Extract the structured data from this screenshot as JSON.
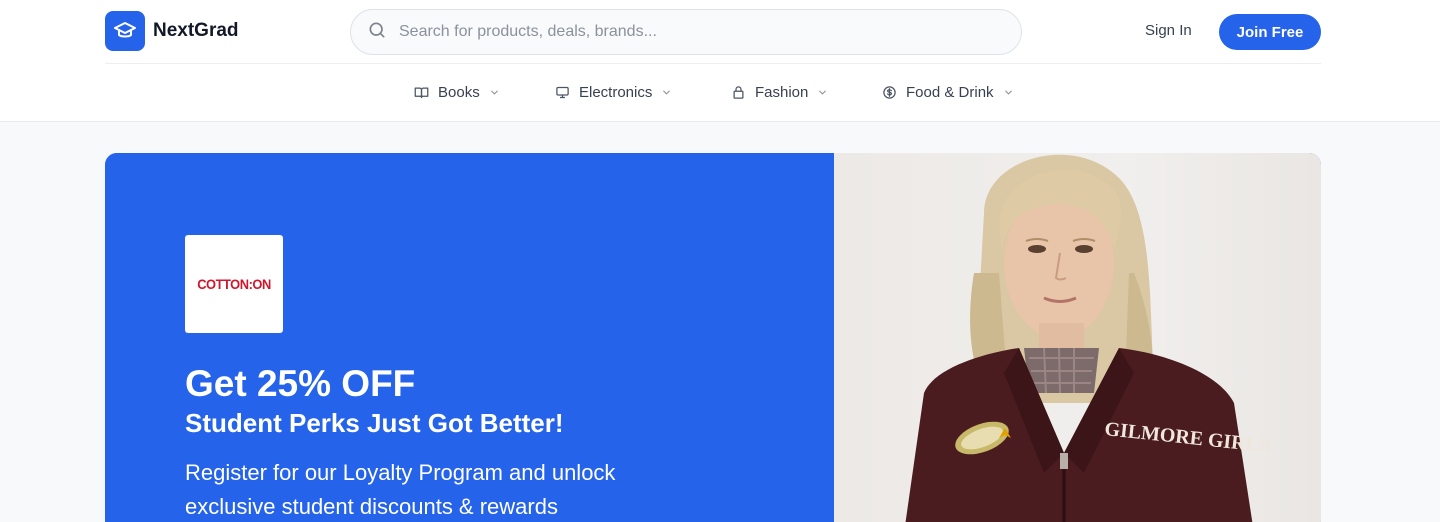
{
  "header": {
    "logo_text": "NextGrad",
    "search_placeholder": "Search for products, deals, brands...",
    "sign_in": "Sign In",
    "join": "Join Free",
    "nav": [
      {
        "label": "Books",
        "icon": "book-icon"
      },
      {
        "label": "Electronics",
        "icon": "monitor-icon"
      },
      {
        "label": "Fashion",
        "icon": "lock-icon"
      },
      {
        "label": "Food & Drink",
        "icon": "dollar-icon"
      }
    ]
  },
  "hero": {
    "brand": "COTTON:ON",
    "title": "Get 25% OFF",
    "subtitle": "Student Perks Just Got Better!",
    "description": "Register for our Loyalty Program and unlock exclusive student discounts & rewards",
    "image_jacket_text": "GILMORE GIRLS"
  },
  "colors": {
    "accent": "#2563eb",
    "brand_red": "#d4142a"
  }
}
